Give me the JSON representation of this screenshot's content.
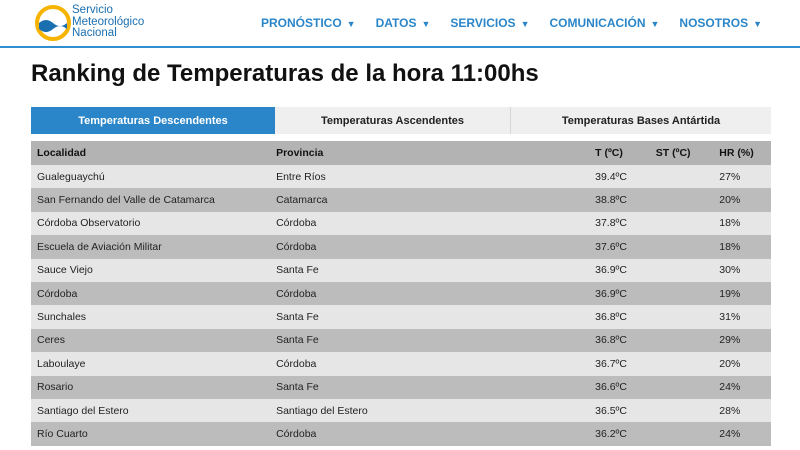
{
  "brand": {
    "line1": "Servicio",
    "line2": "Meteorológico",
    "line3": "Nacional",
    "logo_icon": "smn-logo-icon",
    "colors": {
      "blue": "#1a6fb0",
      "yellow": "#f6b400"
    }
  },
  "nav": [
    {
      "label": "PRONÓSTICO"
    },
    {
      "label": "DATOS"
    },
    {
      "label": "SERVICIOS"
    },
    {
      "label": "COMUNICACIÓN"
    },
    {
      "label": "NOSOTROS"
    }
  ],
  "page_title": "Ranking de Temperaturas de la hora 11:00hs",
  "tabs": [
    {
      "label": "Temperaturas Descendentes",
      "active": true
    },
    {
      "label": "Temperaturas Ascendentes",
      "active": false
    },
    {
      "label": "Temperaturas Bases Antártida",
      "active": false
    }
  ],
  "table": {
    "headers": [
      "Localidad",
      "Provincia",
      "T (ºC)",
      "ST (ºC)",
      "HR (%)"
    ],
    "rows": [
      [
        "Gualeguaychú",
        "Entre Ríos",
        "39.4ºC",
        "",
        "27%"
      ],
      [
        "San Fernando del Valle de Catamarca",
        "Catamarca",
        "38.8ºC",
        "",
        "20%"
      ],
      [
        "Córdoba Observatorio",
        "Córdoba",
        "37.8ºC",
        "",
        "18%"
      ],
      [
        "Escuela de Aviación Militar",
        "Córdoba",
        "37.6ºC",
        "",
        "18%"
      ],
      [
        "Sauce Viejo",
        "Santa Fe",
        "36.9ºC",
        "",
        "30%"
      ],
      [
        "Córdoba",
        "Córdoba",
        "36.9ºC",
        "",
        "19%"
      ],
      [
        "Sunchales",
        "Santa Fe",
        "36.8ºC",
        "",
        "31%"
      ],
      [
        "Ceres",
        "Santa Fe",
        "36.8ºC",
        "",
        "29%"
      ],
      [
        "Laboulaye",
        "Córdoba",
        "36.7ºC",
        "",
        "20%"
      ],
      [
        "Rosario",
        "Santa Fe",
        "36.6ºC",
        "",
        "24%"
      ],
      [
        "Santiago del Estero",
        "Santiago del Estero",
        "36.5ºC",
        "",
        "28%"
      ],
      [
        "Río Cuarto",
        "Córdoba",
        "36.2ºC",
        "",
        "24%"
      ]
    ]
  }
}
